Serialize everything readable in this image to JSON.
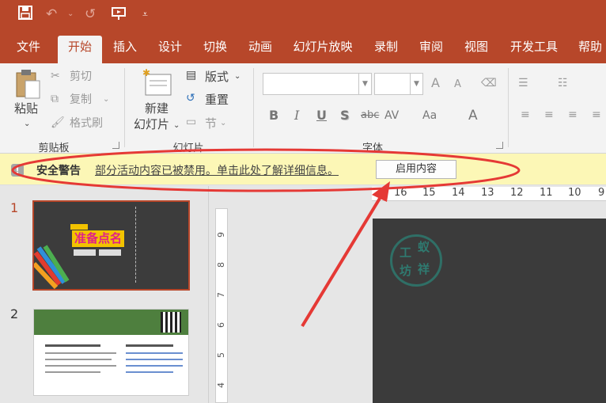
{
  "quick_access": {
    "save_icon": "save-icon",
    "undo_icon": "undo-icon",
    "redo_icon": "redo-icon",
    "present_icon": "slideshow-from-start-icon",
    "customize_icon": "customize-qat-icon"
  },
  "tabs": [
    "文件",
    "开始",
    "插入",
    "设计",
    "切换",
    "动画",
    "幻灯片放映",
    "录制",
    "审阅",
    "视图",
    "开发工具",
    "帮助"
  ],
  "active_tab": "开始",
  "ribbon": {
    "clipboard": {
      "paste_label": "粘贴",
      "cut_label": "剪切",
      "copy_label": "复制",
      "format_painter_label": "格式刷",
      "group_label": "剪贴板"
    },
    "slides": {
      "new_slide_line1": "新建",
      "new_slide_line2": "幻灯片",
      "layout_label": "版式",
      "reset_label": "重置",
      "section_label": "节",
      "group_label": "幻灯片"
    },
    "font": {
      "grow_font": "A",
      "shrink_font": "A",
      "bold": "B",
      "italic": "I",
      "underline": "U",
      "shadow": "S",
      "strikethrough": "abc",
      "char_spacing": "AV",
      "change_case": "Aa",
      "font_color": "A",
      "group_label": "字体"
    }
  },
  "security_bar": {
    "title": "安全警告",
    "message": "部分活动内容已被禁用。单击此处了解详细信息。",
    "enable_button": "启用内容",
    "background": "#fcf7b6"
  },
  "slides_pane": {
    "slide1_number": "1",
    "slide1_title": "准备点名",
    "slide2_number": "2"
  },
  "rulers": {
    "horizontal": [
      "16",
      "15",
      "14",
      "13",
      "12",
      "11",
      "10",
      "9"
    ],
    "vertical": [
      "9",
      "8",
      "7",
      "6",
      "5",
      "4"
    ]
  },
  "canvas": {
    "stamp_chars": [
      "工",
      "蚁",
      "坊",
      "祥"
    ]
  },
  "colors": {
    "accent": "#b7472a",
    "annotation": "#e53935",
    "selected_slide_border": "#b7472a"
  }
}
